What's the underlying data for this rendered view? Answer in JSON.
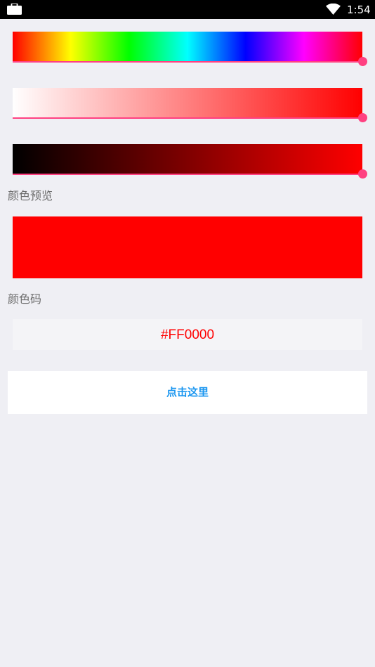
{
  "status_bar": {
    "time": "1:54",
    "icons": [
      "briefcase-icon",
      "wifi-icon",
      "battery-icon"
    ]
  },
  "sliders": [
    {
      "name": "hue",
      "value_fraction": 1.0
    },
    {
      "name": "saturation",
      "value_fraction": 1.0
    },
    {
      "name": "brightness",
      "value_fraction": 1.0
    }
  ],
  "preview": {
    "label": "颜色预览",
    "color": "#FF0000"
  },
  "color_code": {
    "label": "颜色码",
    "value": "#FF0000",
    "text_color": "#FF0000"
  },
  "action_button": {
    "label": "点击这里",
    "color": "#1A96F0"
  },
  "colors": {
    "accent": "#FF4081",
    "background": "#EFEFF4"
  }
}
